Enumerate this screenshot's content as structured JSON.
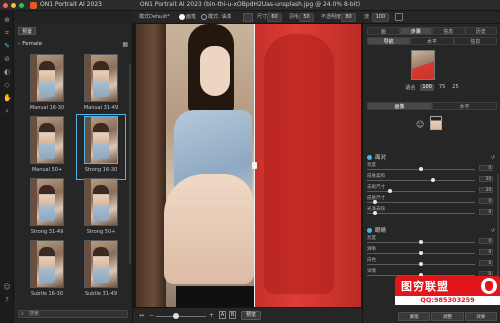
{
  "window": {
    "app_name": "ON1 Portrait AI 2023",
    "title": "ON1 Portrait AI 2023 (bin-thi-u-xOBpdH2Uas-unsplash.jpg @ 24.0% 8-bit)"
  },
  "toolbar": {
    "mode_label": "模式",
    "mode_value": "Default*",
    "opt_a": "画笔",
    "opt_b": "模式: 油漆",
    "size_label": "尺寸",
    "size_value": "60",
    "feather_label": "羽毛",
    "feather_value": "50",
    "opacity_label": "不透明度",
    "opacity_value": "80",
    "flow_label": "流",
    "flow_value": "100"
  },
  "browser": {
    "tab": "预置",
    "crumb": "Female",
    "grid_icon": "grid-icon",
    "presets": [
      {
        "label": "Manual 16-30"
      },
      {
        "label": "Manual 31-49"
      },
      {
        "label": "Manual 50+"
      },
      {
        "label": "Strong 16-30",
        "selected": true
      },
      {
        "label": "Strong 31-49"
      },
      {
        "label": "Strong 50+"
      },
      {
        "label": "Subtle 16-30"
      },
      {
        "label": "Subtle 31-49"
      }
    ],
    "search_placeholder": "搜索"
  },
  "bottombar": {
    "preview_label": "预览",
    "view_a": "A",
    "view_b": "B"
  },
  "right_panel": {
    "top_tabs": [
      "画",
      "步骤",
      "信息",
      "历史"
    ],
    "nav_tabs": [
      "导航",
      "水平",
      "信息"
    ],
    "zoom_levels": [
      "适合",
      "100",
      "75",
      "25"
    ],
    "zoom_active_index": 1,
    "sub_tabs": [
      "画像",
      "水平"
    ],
    "section1": {
      "title": "面对",
      "sliders": [
        {
          "label": "亮度",
          "value": "0",
          "pos": 0.5
        },
        {
          "label": "皮肤柔和",
          "value": "50",
          "pos": 0.62
        },
        {
          "label": "去斑尺寸",
          "value": "20",
          "pos": 0.2
        },
        {
          "label": "皮肤尺寸",
          "value": "0",
          "pos": 0.06
        },
        {
          "label": "光泽去除",
          "value": "0",
          "pos": 0.06
        }
      ]
    },
    "section2": {
      "title": "眼睛",
      "sliders": [
        {
          "label": "亮度",
          "value": "0",
          "pos": 0.5
        },
        {
          "label": "清晰",
          "value": "0",
          "pos": 0.5
        },
        {
          "label": "白色",
          "value": "0",
          "pos": 0.5
        },
        {
          "label": "详情",
          "value": "0",
          "pos": 0.5
        }
      ]
    }
  },
  "watermark": {
    "title": "图穷联盟",
    "sub": "QQ:985303259"
  },
  "footer_tabs": [
    "蒙版",
    "调整",
    "效果"
  ],
  "colors": {
    "accent": "#4fb3e8",
    "mask_red": "#d83a32",
    "watermark_red": "#e1161b"
  }
}
